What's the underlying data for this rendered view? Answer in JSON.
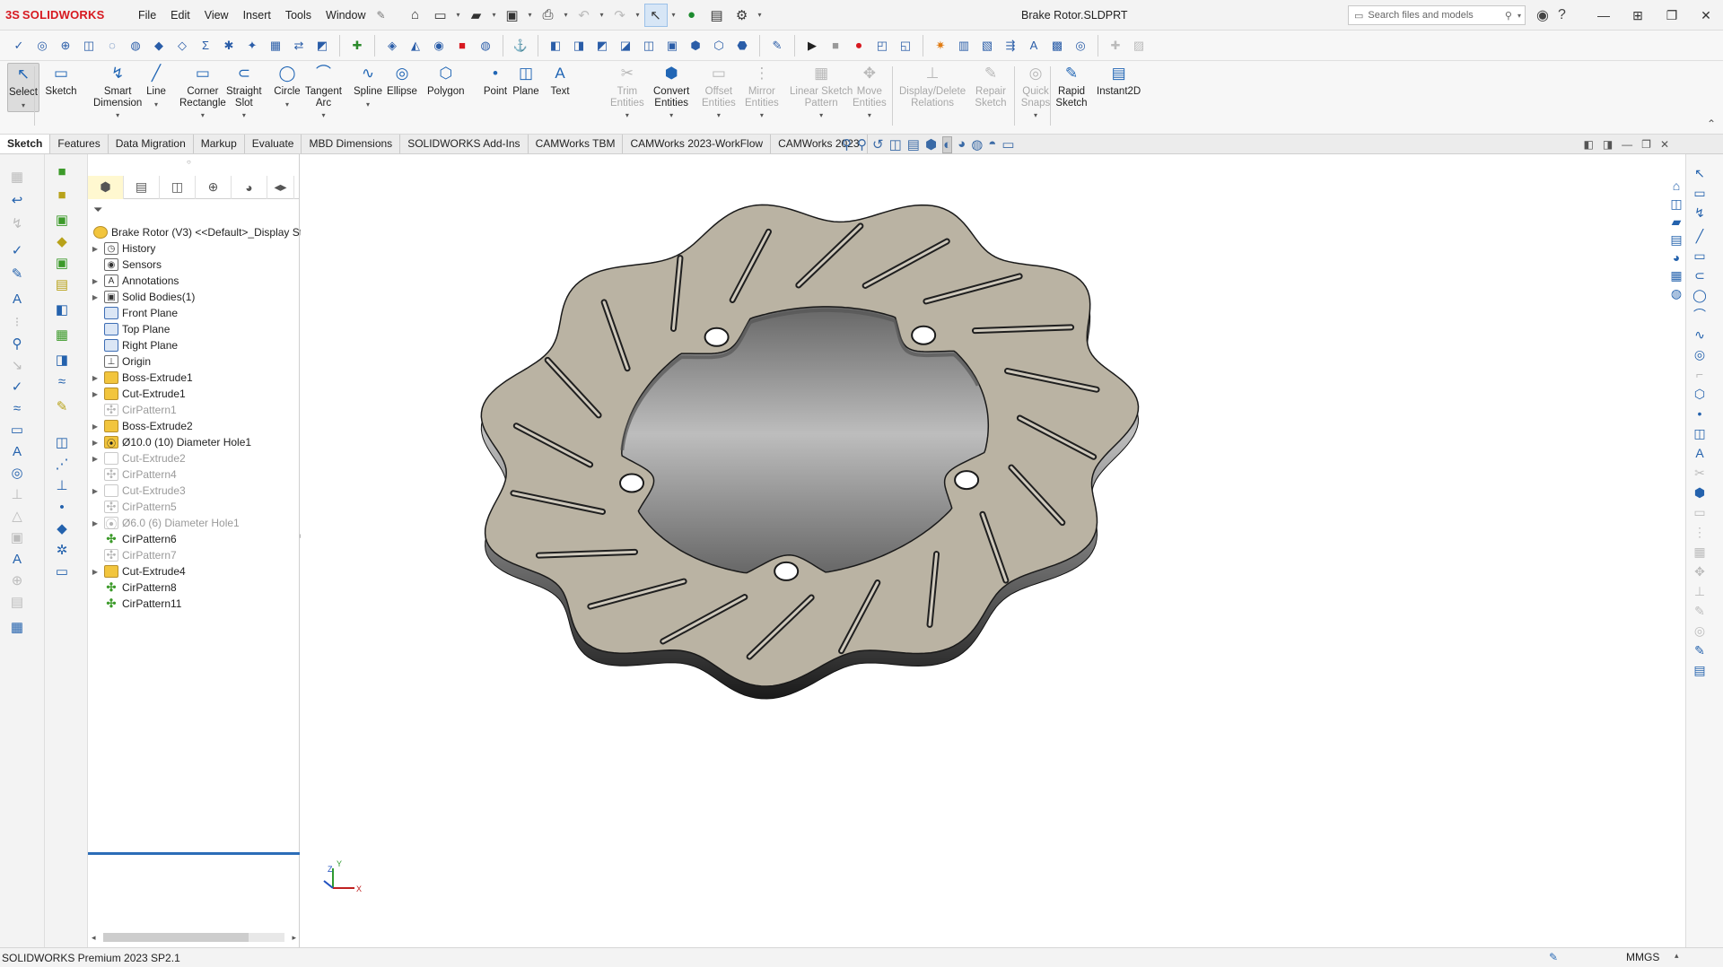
{
  "app": {
    "brand": "SOLIDWORKS",
    "document_title": "Brake Rotor.SLDPRT",
    "search_placeholder": "Search files and models"
  },
  "menu": [
    "File",
    "Edit",
    "View",
    "Insert",
    "Tools",
    "Window"
  ],
  "command_manager": {
    "commands": [
      {
        "label": "Select",
        "icon": "cursor-icon",
        "enabled": true,
        "selected": true
      },
      {
        "label": "Sketch",
        "icon": "sketch-icon",
        "enabled": true
      },
      {
        "label": "Smart\nDimension",
        "icon": "smart-dimension-icon",
        "enabled": true
      },
      {
        "label": "Line",
        "icon": "line-icon",
        "enabled": true
      },
      {
        "label": "Corner\nRectangle",
        "icon": "rectangle-icon",
        "enabled": true
      },
      {
        "label": "Straight\nSlot",
        "icon": "slot-icon",
        "enabled": true
      },
      {
        "label": "Circle",
        "icon": "circle-icon",
        "enabled": true
      },
      {
        "label": "Tangent\nArc",
        "icon": "arc-icon",
        "enabled": true
      },
      {
        "label": "Spline",
        "icon": "spline-icon",
        "enabled": true
      },
      {
        "label": "Ellipse",
        "icon": "ellipse-icon",
        "enabled": true
      },
      {
        "label": "Polygon",
        "icon": "polygon-icon",
        "enabled": true
      },
      {
        "label": "Point",
        "icon": "point-icon",
        "enabled": true
      },
      {
        "label": "Plane",
        "icon": "plane-icon",
        "enabled": true
      },
      {
        "label": "Text",
        "icon": "text-icon",
        "enabled": true
      },
      {
        "label": "Trim\nEntities",
        "icon": "trim-icon",
        "enabled": false
      },
      {
        "label": "Convert\nEntities",
        "icon": "convert-icon",
        "enabled": true
      },
      {
        "label": "Offset\nEntities",
        "icon": "offset-icon",
        "enabled": false
      },
      {
        "label": "Mirror\nEntities",
        "icon": "mirror-icon",
        "enabled": false
      },
      {
        "label": "Linear Sketch\nPattern",
        "icon": "linear-pattern-icon",
        "enabled": false
      },
      {
        "label": "Move\nEntities",
        "icon": "move-icon",
        "enabled": false
      },
      {
        "label": "Display/Delete\nRelations",
        "icon": "relations-icon",
        "enabled": false
      },
      {
        "label": "Repair\nSketch",
        "icon": "repair-icon",
        "enabled": false
      },
      {
        "label": "Quick\nSnaps",
        "icon": "snaps-icon",
        "enabled": false
      },
      {
        "label": "Rapid\nSketch",
        "icon": "rapid-sketch-icon",
        "enabled": true
      },
      {
        "label": "Instant2D",
        "icon": "instant2d-icon",
        "enabled": true
      }
    ]
  },
  "tabs": [
    "Sketch",
    "Features",
    "Data Migration",
    "Markup",
    "Evaluate",
    "MBD Dimensions",
    "SOLIDWORKS Add-Ins",
    "CAMWorks TBM",
    "CAMWorks 2023-WorkFlow",
    "CAMWorks 2023"
  ],
  "active_tab": "Sketch",
  "feature_tree": {
    "root": "Brake Rotor (V3) <<Default>_Display Sta",
    "items": [
      {
        "label": "History",
        "icon": "history-icon",
        "expandable": true,
        "suppressed": false
      },
      {
        "label": "Sensors",
        "icon": "sensor-icon",
        "expandable": false,
        "suppressed": false
      },
      {
        "label": "Annotations",
        "icon": "annotation-icon",
        "expandable": true,
        "suppressed": false
      },
      {
        "label": "Solid Bodies(1)",
        "icon": "solid-bodies-icon",
        "expandable": true,
        "suppressed": false
      },
      {
        "label": "Front Plane",
        "icon": "plane-icon",
        "expandable": false,
        "suppressed": false
      },
      {
        "label": "Top Plane",
        "icon": "plane-icon",
        "expandable": false,
        "suppressed": false
      },
      {
        "label": "Right Plane",
        "icon": "plane-icon",
        "expandable": false,
        "suppressed": false
      },
      {
        "label": "Origin",
        "icon": "origin-icon",
        "expandable": false,
        "suppressed": false
      },
      {
        "label": "Boss-Extrude1",
        "icon": "boss-extrude-icon",
        "expandable": true,
        "suppressed": false
      },
      {
        "label": "Cut-Extrude1",
        "icon": "cut-extrude-icon",
        "expandable": true,
        "suppressed": false
      },
      {
        "label": "CirPattern1",
        "icon": "circular-pattern-icon",
        "expandable": false,
        "suppressed": true
      },
      {
        "label": "Boss-Extrude2",
        "icon": "boss-extrude-icon",
        "expandable": true,
        "suppressed": false
      },
      {
        "label": "Ø10.0 (10) Diameter Hole1",
        "icon": "hole-wizard-icon",
        "expandable": true,
        "suppressed": false
      },
      {
        "label": "Cut-Extrude2",
        "icon": "cut-extrude-icon",
        "expandable": true,
        "suppressed": true
      },
      {
        "label": "CirPattern4",
        "icon": "circular-pattern-icon",
        "expandable": false,
        "suppressed": true
      },
      {
        "label": "Cut-Extrude3",
        "icon": "cut-extrude-icon",
        "expandable": true,
        "suppressed": true
      },
      {
        "label": "CirPattern5",
        "icon": "circular-pattern-icon",
        "expandable": false,
        "suppressed": true
      },
      {
        "label": "Ø6.0 (6) Diameter Hole1",
        "icon": "hole-wizard-icon",
        "expandable": true,
        "suppressed": true
      },
      {
        "label": "CirPattern6",
        "icon": "circular-pattern-icon",
        "expandable": false,
        "suppressed": false
      },
      {
        "label": "CirPattern7",
        "icon": "circular-pattern-icon",
        "expandable": false,
        "suppressed": true
      },
      {
        "label": "Cut-Extrude4",
        "icon": "cut-extrude-icon",
        "expandable": true,
        "suppressed": false
      },
      {
        "label": "CirPattern8",
        "icon": "circular-pattern-icon",
        "expandable": false,
        "suppressed": false
      },
      {
        "label": "CirPattern11",
        "icon": "circular-pattern-icon",
        "expandable": false,
        "suppressed": false
      }
    ]
  },
  "triad": {
    "x": "X",
    "y": "Y",
    "z": "Z"
  },
  "status": {
    "product": "SOLIDWORKS Premium 2023 SP2.1",
    "units": "MMGS"
  },
  "colors": {
    "rotor_face": "#bab3a3",
    "rotor_edge": "#1e1e1e",
    "brand_red": "#d71920",
    "accent_blue": "#2b6cb7"
  }
}
